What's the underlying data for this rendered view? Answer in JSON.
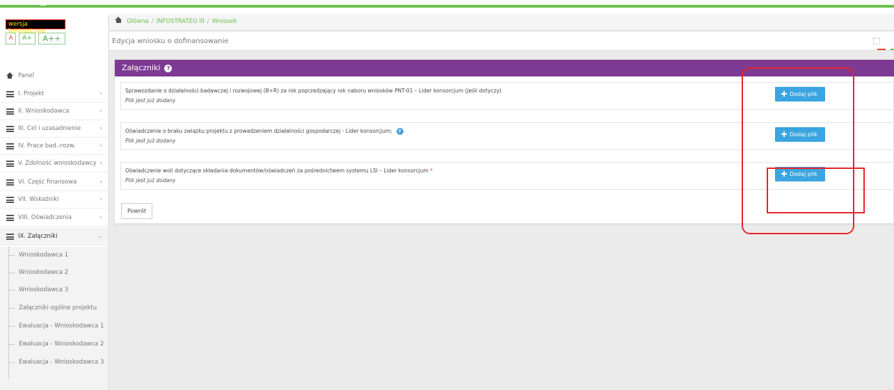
{
  "contrast_label": "wersja kontrastowa",
  "font_sizes": [
    "A",
    "A+",
    "A++"
  ],
  "nav": {
    "panel": "Panel",
    "items": [
      {
        "label": "I. Projekt"
      },
      {
        "label": "II. Wnioskodawca"
      },
      {
        "label": "III. Cel i uzasadnienie"
      },
      {
        "label": "IV. Prace bad.-rozw."
      },
      {
        "label": "V. Zdolność wnioskodawcy"
      },
      {
        "label": "VI. Część finansowa"
      },
      {
        "label": "VII. Wskaźniki"
      },
      {
        "label": "VIII. Oświadczenia"
      },
      {
        "label": "IX. Załączniki"
      }
    ],
    "subitems": [
      "Wnioskodawca 1",
      "Wnioskodawca 2",
      "Wnioskodawca 3",
      "Załączniki ogólne projektu",
      "Ewaluacja - Wnioskodawca 1",
      "Ewaluacja - Wnioskodawca 2",
      "Ewaluacja - Wnioskodawca 3"
    ]
  },
  "breadcrumb": [
    "Główna",
    "INFOSTRATEG III",
    "Wniosek"
  ],
  "page_title": "Edycja wniosku o dofinansowanie",
  "panel": {
    "title": "Załączniki",
    "rows": [
      {
        "title": "Sprawozdanie o działalności badawczej i rozwojowej (B+R) za rok poprzedzający rok naboru wniosków PNT-01 – Lider konsorcjum (jeśli dotyczy)",
        "status": "Plik jest już dodany",
        "button": "Dodaj plik"
      },
      {
        "title": "Oświadczenie o braku związku projektu z prowadzeniem działalności gospodarczej - Lider konsorcjum;",
        "status": "Plik jest już dodany",
        "button": "Dodaj plik"
      },
      {
        "title": "Oświadczenie woli dotyczące składania dokumentów/oświadczeń za pośrednictwem systemu LSI – Lider konsorcjum",
        "required_mark": "*",
        "status": "Plik jest już dodany",
        "button": "Dodaj plik"
      }
    ],
    "back_button": "Powrót"
  },
  "colors": {
    "green": "#6abf4b",
    "purple": "#7d3a93",
    "button_blue": "#3aa5e0",
    "annotation_red": "#e8232a"
  }
}
